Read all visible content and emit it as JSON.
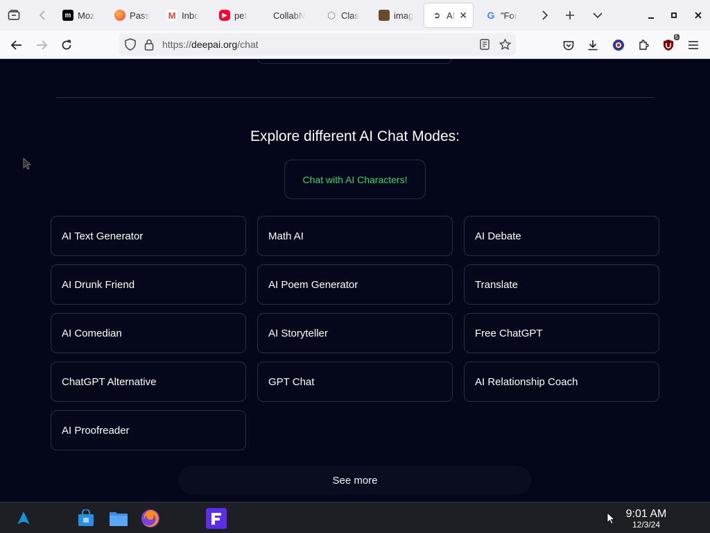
{
  "browser": {
    "tabs": [
      {
        "title": "Moz",
        "favicon": "m-icon",
        "color": "#000000",
        "active": false
      },
      {
        "title": "Pass",
        "favicon": "firefox-icon",
        "color": "#ff7139",
        "active": false
      },
      {
        "title": "Inbo",
        "favicon": "gmail-icon",
        "color": "#ea4335",
        "active": false
      },
      {
        "title": "pet",
        "favicon": "youtube-icon",
        "color": "#ff0033",
        "active": false
      },
      {
        "title": "CollabN",
        "favicon": "",
        "color": "",
        "active": false
      },
      {
        "title": "Clas",
        "favicon": "hexagon-icon",
        "color": "#888888",
        "active": false
      },
      {
        "title": "imag",
        "favicon": "image-icon",
        "color": "#6b4a2a",
        "active": false
      },
      {
        "title": "AI",
        "favicon": "deepai-icon",
        "color": "#222222",
        "active": true
      },
      {
        "title": "\"For",
        "favicon": "google-icon",
        "color": "#4285f4",
        "active": false
      }
    ],
    "url_scheme": "https://",
    "url_host": "deepai.org",
    "url_path": "/chat",
    "extension_badge": "5"
  },
  "page": {
    "section_title": "Explore different AI Chat Modes:",
    "characters_button": "Chat with AI Characters!",
    "modes": [
      "AI Text Generator",
      "Math AI",
      "AI Debate",
      "AI Drunk Friend",
      "AI Poem Generator",
      "Translate",
      "AI Comedian",
      "AI Storyteller",
      "Free ChatGPT",
      "ChatGPT Alternative",
      "GPT Chat",
      "AI Relationship Coach",
      "AI Proofreader"
    ],
    "see_more": "See more"
  },
  "taskbar": {
    "time": "9:01 AM",
    "date": "12/3/24"
  },
  "colors": {
    "page_bg": "#04061a",
    "accent_green": "#38d86c",
    "card_border": "#2b2e40"
  }
}
